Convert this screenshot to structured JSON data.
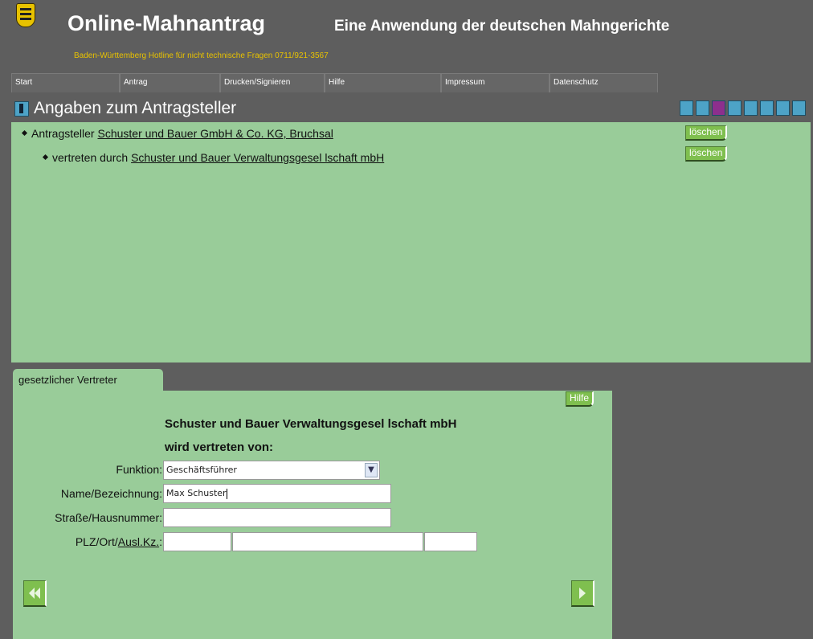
{
  "header": {
    "title": "Online-Mahnantrag",
    "subtitle": "Eine Anwendung der deutschen Mahngerichte",
    "hotline": "Baden-Württemberg  Hotline für nicht technische Fragen 0711/921-3567"
  },
  "nav": {
    "items": [
      "Start",
      "Antrag",
      "Drucken/Signieren",
      "Hilfe",
      "Impressum",
      "Datenschutz"
    ]
  },
  "section": {
    "title": "Angaben zum Antragsteller",
    "toolbar_icons": [
      "persons-icon",
      "person-blue-icon",
      "person-purple-icon",
      "stamp-icon",
      "document-icon",
      "list-icon",
      "page-icon",
      "save-icon"
    ],
    "toolbar_colors": [
      "#4da3c7",
      "#4da3c7",
      "#8d2f8d",
      "#4da3c7",
      "#4da3c7",
      "#4da3c7",
      "#4da3c7",
      "#4da3c7"
    ]
  },
  "tree": {
    "applicant_prefix": "Antragsteller",
    "applicant_link": "Schuster und Bauer GmbH & Co. KG, Bruchsal",
    "rep_prefix": "vertreten durch",
    "rep_link": "Schuster und Bauer Verwaltungsgesel lschaft mbH",
    "delete_label": "löschen"
  },
  "form": {
    "tab_label": "gesetzlicher Vertreter",
    "help_label": "Hilfe",
    "represented_name": "Schuster und Bauer Verwaltungsgesel lschaft mbH",
    "represented_by": "wird vertreten von:",
    "function_label": "Funktion:",
    "function_value": "Geschäftsführer",
    "name_label": "Name/Bezeichnung:",
    "name_value": "Max Schuster",
    "street_label": "Straße/Hausnummer:",
    "street_value": "",
    "plz_label_prefix": "PLZ/Ort/",
    "plz_label_link": "Ausl.Kz.",
    "plz_label_suffix": ":",
    "plz_value": "",
    "city_value": "",
    "country_value": ""
  },
  "colors": {
    "background": "#5e5e5e",
    "panel": "#99cc99",
    "accent": "#e8c200",
    "button": "#7fbf4f"
  }
}
